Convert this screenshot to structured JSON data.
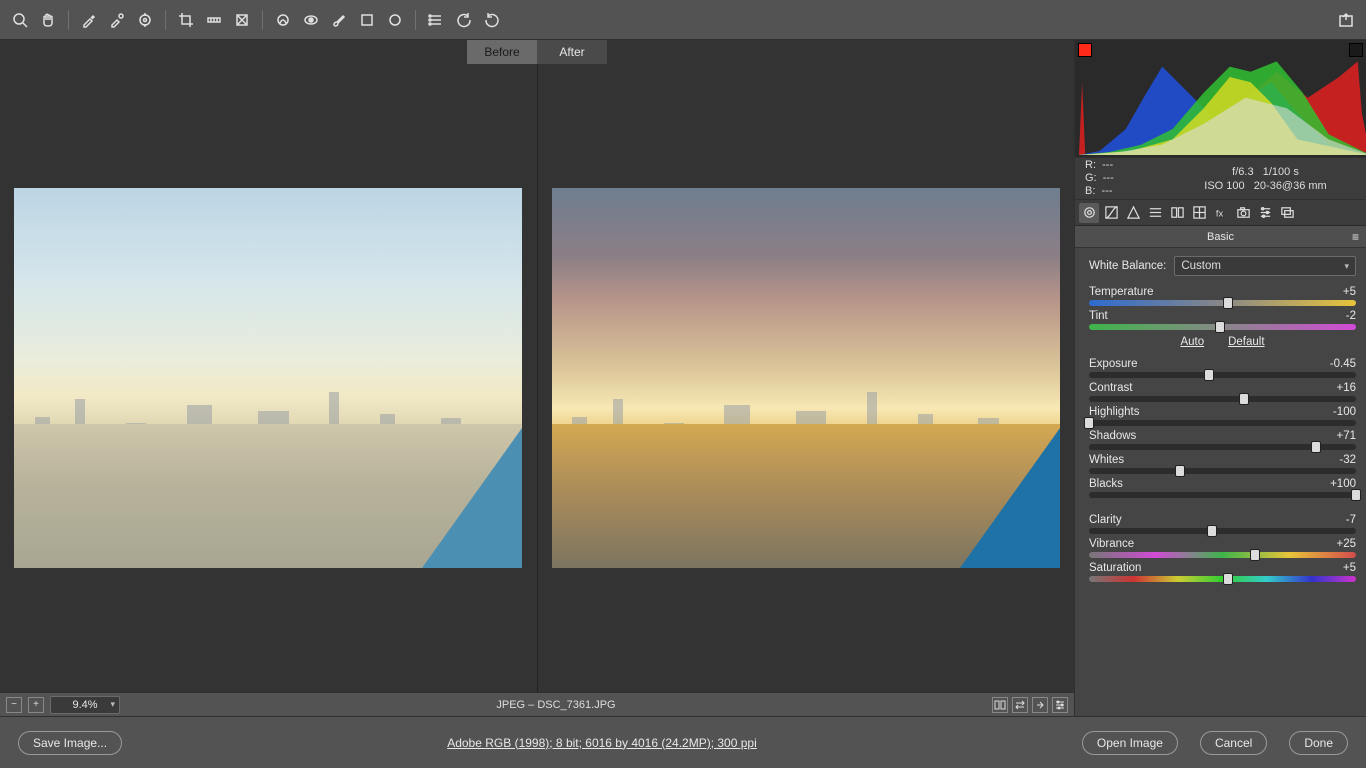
{
  "toolbar": {
    "tools": [
      "zoom",
      "hand",
      "eyedropper",
      "eyedropper-plus",
      "eyedropper-target",
      "crop",
      "ruler",
      "perspective",
      "spot-heal",
      "redeye",
      "brush",
      "square",
      "oval",
      "list",
      "undo",
      "redo"
    ],
    "export_icon": "export"
  },
  "tabs": {
    "before": "Before",
    "after": "After"
  },
  "canvas_status": {
    "zoom": "9.4%",
    "file_label": "JPEG  –  DSC_7361.JPG"
  },
  "histogram": {
    "rgb": {
      "r_label": "R:",
      "g_label": "G:",
      "b_label": "B:",
      "dash": "---"
    },
    "exif_line1_a": "f/6.3",
    "exif_line1_b": "1/100 s",
    "exif_line2_a": "ISO 100",
    "exif_line2_b": "20-36@36 mm"
  },
  "panel": {
    "title": "Basic",
    "wb_label": "White Balance:",
    "wb_value": "Custom",
    "auto": "Auto",
    "default": "Default",
    "sliders": {
      "temperature": {
        "label": "Temperature",
        "value": "+5",
        "pos": 52
      },
      "tint": {
        "label": "Tint",
        "value": "-2",
        "pos": 49
      },
      "exposure": {
        "label": "Exposure",
        "value": "-0.45",
        "pos": 45
      },
      "contrast": {
        "label": "Contrast",
        "value": "+16",
        "pos": 58
      },
      "highlights": {
        "label": "Highlights",
        "value": "-100",
        "pos": 0
      },
      "shadows": {
        "label": "Shadows",
        "value": "+71",
        "pos": 85
      },
      "whites": {
        "label": "Whites",
        "value": "-32",
        "pos": 34
      },
      "blacks": {
        "label": "Blacks",
        "value": "+100",
        "pos": 100
      },
      "clarity": {
        "label": "Clarity",
        "value": "-7",
        "pos": 46
      },
      "vibrance": {
        "label": "Vibrance",
        "value": "+25",
        "pos": 62
      },
      "saturation": {
        "label": "Saturation",
        "value": "+5",
        "pos": 52
      }
    }
  },
  "bottom": {
    "save": "Save Image...",
    "profile": "Adobe RGB (1998); 8 bit; 6016 by 4016 (24.2MP); 300 ppi",
    "open": "Open Image",
    "cancel": "Cancel",
    "done": "Done"
  }
}
